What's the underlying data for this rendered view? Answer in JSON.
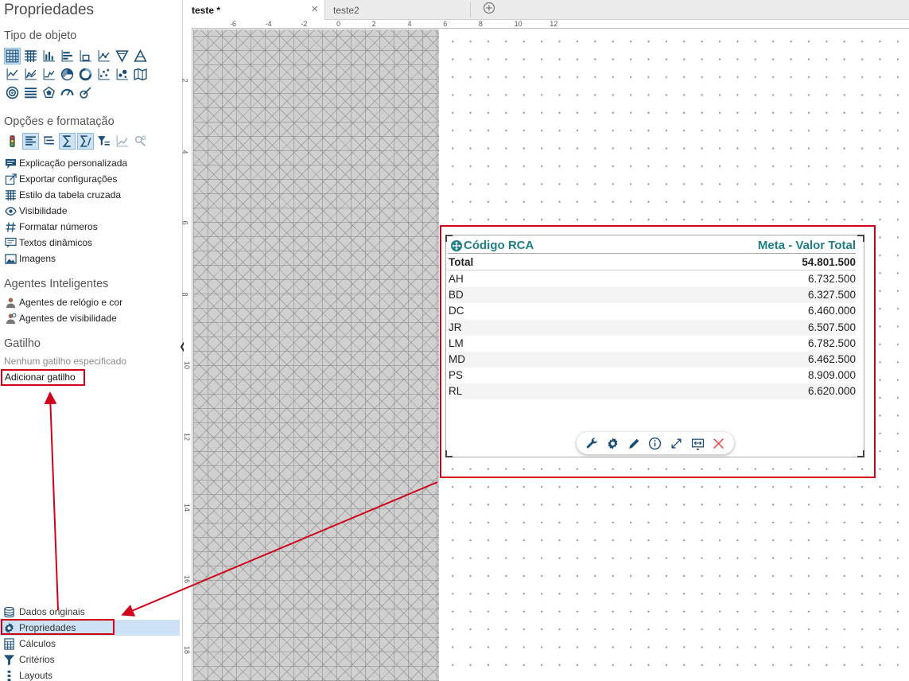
{
  "panel": {
    "title": "Propriedades",
    "object_type": {
      "title": "Tipo de objeto",
      "rows": [
        [
          "crosstab-icon",
          "table-icon",
          "bar-chart-icon",
          "horizontal-bar-icon",
          "area-bar-icon",
          "line-bar-icon",
          "funnel-icon",
          "pyramid-icon"
        ],
        [
          "line-chart-icon",
          "area-chart-icon",
          "stacked-area-icon",
          "pie-chart-icon",
          "donut-chart-icon",
          "scatter-icon",
          "bubble-icon",
          "map-icon"
        ],
        [
          "target-icon",
          "list-icon",
          "radar-icon",
          "gauge-icon",
          "meter-icon"
        ]
      ]
    },
    "options": {
      "title": "Opções e formatação",
      "icons": [
        "traffic-light-icon",
        "align-icon",
        "hierarchy-icon",
        "sum-icon",
        "subtotal-icon",
        "filter-list-icon",
        "trend-icon",
        "settings-small-icon"
      ],
      "links": [
        {
          "label": "Explicação personalizada",
          "icon": "comment-icon"
        },
        {
          "label": "Exportar configurações",
          "icon": "export-icon"
        },
        {
          "label": "Estilo da tabela cruzada",
          "icon": "grid-style-icon"
        },
        {
          "label": "Visibilidade",
          "icon": "eye-icon"
        },
        {
          "label": "Formatar números",
          "icon": "hash-icon"
        },
        {
          "label": "Textos dinâmicos",
          "icon": "dynamic-text-icon"
        },
        {
          "label": "Imagens",
          "icon": "image-icon"
        }
      ]
    },
    "agents": {
      "title": "Agentes Inteligentes",
      "links": [
        {
          "label": "Agentes de relógio e cor",
          "icon": "agent-clock-icon"
        },
        {
          "label": "Agentes de visibilidade",
          "icon": "agent-visibility-icon"
        }
      ]
    },
    "trigger": {
      "title": "Gatilho",
      "none": "Nenhum gatilho especificado",
      "add": "Adicionar gatilho"
    },
    "nav": [
      {
        "label": "Dados originais",
        "icon": "database-icon"
      },
      {
        "label": "Propriedades",
        "icon": "gear-icon",
        "active": true
      },
      {
        "label": "Cálculos",
        "icon": "calculator-icon"
      },
      {
        "label": "Critérios",
        "icon": "filter-icon"
      },
      {
        "label": "Layouts",
        "icon": "layout-icon"
      }
    ]
  },
  "tabs": [
    {
      "label": "teste *",
      "active": true
    },
    {
      "label": "teste2",
      "active": false
    }
  ],
  "ruler": {
    "h_labels": [
      "-6",
      "-4",
      "-2",
      "0",
      "2",
      "4",
      "6",
      "8",
      "10",
      "12"
    ],
    "v_labels": [
      "2",
      "4",
      "6",
      "8",
      "10",
      "12",
      "14",
      "16",
      "18"
    ]
  },
  "widget": {
    "col1": "Código RCA",
    "col2": "Meta - Valor Total",
    "total_label": "Total",
    "total_value": "54.801.500",
    "rows": [
      {
        "code": "AH",
        "value": "6.732.500"
      },
      {
        "code": "BD",
        "value": "6.327.500"
      },
      {
        "code": "DC",
        "value": "6.460.000"
      },
      {
        "code": "JR",
        "value": "6.507.500"
      },
      {
        "code": "LM",
        "value": "6.782.500"
      },
      {
        "code": "MD",
        "value": "6.462.500"
      },
      {
        "code": "PS",
        "value": "8.909.000"
      },
      {
        "code": "RL",
        "value": "6.620.000"
      }
    ],
    "toolbar": [
      "wrench-icon",
      "gear-icon",
      "pencil-icon",
      "info-icon",
      "expand-icon",
      "resize-icon",
      "close-icon"
    ]
  },
  "colors": {
    "accent_teal": "#1f7f87",
    "icon_blue": "#1a4f7a",
    "highlight_red": "#d0021b",
    "selection_blue": "#cde3f5"
  }
}
